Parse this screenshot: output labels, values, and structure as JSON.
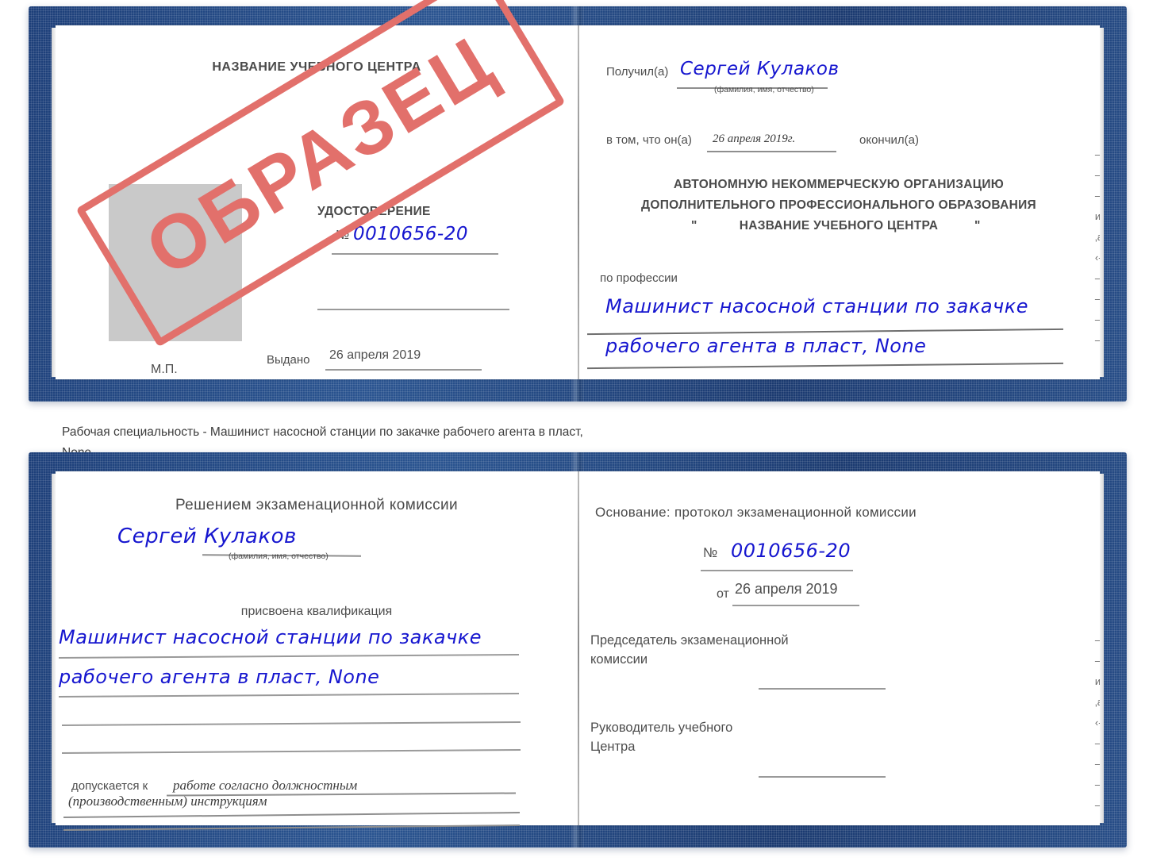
{
  "colors": {
    "cover_blue": "#1d3f79",
    "handwriting_blue": "#1616cf",
    "stamp_red": "#e2706b",
    "photo_grey": "#c9c9c9",
    "rule_grey": "#9a9a9a"
  },
  "stamp": {
    "text": "ОБРАЗЕЦ"
  },
  "caption": {
    "line1": "Рабочая специальность - Машинист насосной станции по закачке рабочего агента в пласт,",
    "line2": "None"
  },
  "certificate_top": {
    "left_page": {
      "center_name": "НАЗВАНИЕ УЧЕБНОГО ЦЕНТРА",
      "doc_title": "УДОСТОВЕРЕНИЕ",
      "number_prefix": "№",
      "number_value": "0010656-20",
      "issued_label": "Выдано",
      "issued_date": "26 апреля 2019",
      "seal_label": "М.П."
    },
    "right_page": {
      "received_label": "Получил(а)",
      "received_name": "Сергей Кулаков",
      "name_hint": "(фамилия, имя, отчество)",
      "that_he_label": "в том, что он(а)",
      "completion_date": "26 апреля 2019г.",
      "finished_label": "окончил(а)",
      "org_line1": "АВТОНОМНУЮ НЕКОММЕРЧЕСКУЮ ОРГАНИЗАЦИЮ",
      "org_line2": "ДОПОЛНИТЕЛЬНОГО ПРОФЕССИОНАЛЬНОГО ОБРАЗОВАНИЯ",
      "org_quote_open": "\"",
      "org_line3": "НАЗВАНИЕ УЧЕБНОГО ЦЕНТРА",
      "org_quote_close": "\"",
      "profession_label": "по профессии",
      "profession_line1": "Машинист насосной станции по закачке",
      "profession_line2": "рабочего агента в пласт, None",
      "edge_fragments": [
        "–",
        "–",
        "–",
        "и",
        "‚а",
        "‹-",
        "–",
        "–",
        "–",
        "–"
      ]
    }
  },
  "certificate_bottom": {
    "left_page": {
      "heading": "Решением экзаменационной комиссии",
      "name": "Сергей Кулаков",
      "name_hint": "(фамилия, имя, отчество)",
      "qualification_label": "присвоена квалификация",
      "qualification_line1": "Машинист насосной станции по закачке",
      "qualification_line2": "рабочего агента в пласт, None",
      "admitted_label": "допускается к",
      "admitted_line1": "работе согласно должностным",
      "admitted_line2": "(производственным) инструкциям"
    },
    "right_page": {
      "basis_label": "Основание: протокол экзаменационной комиссии",
      "number_prefix": "№",
      "number_value": "0010656-20",
      "date_prefix": "от",
      "date_value": "26 апреля 2019",
      "chairman_line1": "Председатель экзаменационной",
      "chairman_line2": "комиссии",
      "head_line1": "Руководитель учебного",
      "head_line2": "Центра",
      "edge_fragments": [
        "–",
        "–",
        "и",
        "‚а",
        "‹-",
        "–",
        "–",
        "–",
        "–"
      ]
    }
  }
}
